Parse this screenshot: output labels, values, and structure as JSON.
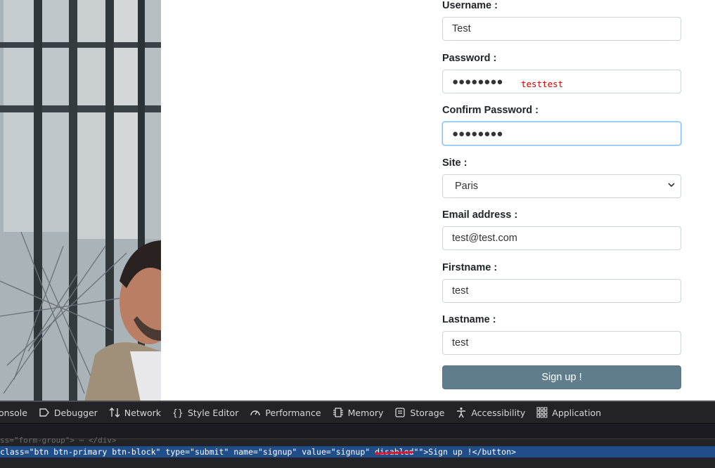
{
  "form": {
    "username": {
      "label": "Username :",
      "value": "Test"
    },
    "password": {
      "label": "Password :",
      "value": "●●●●●●●●",
      "annotation": "testtest"
    },
    "confirm_password": {
      "label": "Confirm Password :",
      "value": "●●●●●●●●"
    },
    "site": {
      "label": "Site :",
      "selected": "Paris"
    },
    "email": {
      "label": "Email address :",
      "value": "test@test.com"
    },
    "firstname": {
      "label": "Firstname :",
      "value": "test"
    },
    "lastname": {
      "label": "Lastname :",
      "value": "test"
    },
    "submit_label": "Sign up !"
  },
  "devtools": {
    "tabs": [
      {
        "label": "onsole",
        "icon": "console-icon"
      },
      {
        "label": "Debugger",
        "icon": "debugger-icon"
      },
      {
        "label": "Network",
        "icon": "network-icon"
      },
      {
        "label": "Style Editor",
        "icon": "style-editor-icon"
      },
      {
        "label": "Performance",
        "icon": "performance-icon"
      },
      {
        "label": "Memory",
        "icon": "memory-icon"
      },
      {
        "label": "Storage",
        "icon": "storage-icon"
      },
      {
        "label": "Accessibility",
        "icon": "accessibility-icon"
      },
      {
        "label": "Application",
        "icon": "application-icon"
      }
    ],
    "dim_line": "ss=\"form-group\">",
    "dim_line_end": "</div>",
    "selected_line_prefix": "class=\"btn btn-primary btn-block\" type=\"submit\" name=\"signup\" value=\"signup\" ",
    "selected_line_struck": "disabled",
    "selected_line_suffix": "\"\">Sign up !</button>"
  },
  "colors": {
    "button": "#607d8b",
    "focus": "#80bdff",
    "selection": "#204e8a",
    "annotation": "#d40000"
  }
}
